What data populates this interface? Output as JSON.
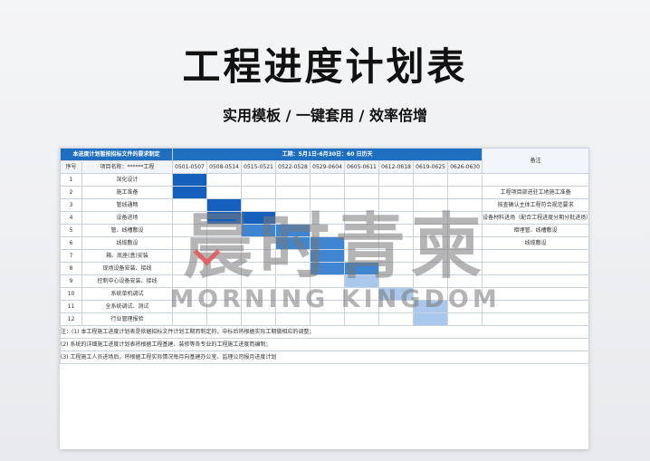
{
  "page": {
    "title": "工程进度计划表",
    "subtitle": "实用模板 / 一键套用 / 效率倍增"
  },
  "table": {
    "top_left_header": "本进度计划暂按招标文件的要求制定",
    "duration_header": "工期：5月1日-6月30日：60 日历天",
    "remarks_header": "备注",
    "col_seq": "序号",
    "col_project": "项目名称：******工程",
    "periods": [
      "0501-0507",
      "0508-0514",
      "0515-0521",
      "0522-0528",
      "0529-0604",
      "0605-0611",
      "0612-0618",
      "0619-0625",
      "0626-0630"
    ],
    "rows": [
      {
        "no": "1",
        "name": "深化设计",
        "remark": ""
      },
      {
        "no": "2",
        "name": "施工准备",
        "remark": "工程项目部进驻工地施工准备"
      },
      {
        "no": "3",
        "name": "管线通畅",
        "remark": "核查确认主体工程符合规范要求"
      },
      {
        "no": "4",
        "name": "设备进场",
        "remark": "设备材料进场（配合工程进度分期分批进场）"
      },
      {
        "no": "5",
        "name": "管、线槽敷设",
        "remark": "暗埋管、线槽敷设"
      },
      {
        "no": "6",
        "name": "线缆敷设",
        "remark": "线缆敷设"
      },
      {
        "no": "7",
        "name": "箱、底座(盒)安装",
        "remark": ""
      },
      {
        "no": "8",
        "name": "现场设备安装、接线",
        "remark": ""
      },
      {
        "no": "9",
        "name": "控制中心设备安装、接线",
        "remark": ""
      },
      {
        "no": "10",
        "name": "系统单机调试",
        "remark": ""
      },
      {
        "no": "11",
        "name": "全系统调试、测试",
        "remark": ""
      },
      {
        "no": "12",
        "name": "行业管理报验",
        "remark": ""
      }
    ],
    "bars": [
      {
        "row": 0,
        "start": 0,
        "end": 1,
        "shade": "dark"
      },
      {
        "row": 1,
        "start": 0,
        "end": 1,
        "shade": "dark"
      },
      {
        "row": 2,
        "start": 1,
        "end": 2,
        "shade": "dark"
      },
      {
        "row": 3,
        "start": 1,
        "end": 3,
        "shade": "dark"
      },
      {
        "row": 4,
        "start": 2,
        "end": 4,
        "shade": "mid"
      },
      {
        "row": 5,
        "start": 3,
        "end": 5,
        "shade": "mid"
      },
      {
        "row": 6,
        "start": 4,
        "end": 5,
        "shade": "mid"
      },
      {
        "row": 7,
        "start": 4,
        "end": 6,
        "shade": "mid"
      },
      {
        "row": 8,
        "start": 5,
        "end": 6,
        "shade": "light"
      },
      {
        "row": 9,
        "start": 6,
        "end": 7,
        "shade": "light"
      },
      {
        "row": 10,
        "start": 7,
        "end": 8,
        "shade": "light"
      },
      {
        "row": 11,
        "start": 7,
        "end": 8,
        "shade": "light"
      }
    ],
    "notes": [
      "注：(1) 本工程施工进度计划表是依据招标文件计划工期而制定的，中标后将根据实际工期做相应的调整；",
      "(2) 系统的详细施工进度计划表将根据工程基建、装修等各专业的工程施工进度而编制；",
      "(3) 工程施工人员进场后，将根据工程实际情况每月向基建办公室、监理公司报月进度计划"
    ]
  },
  "watermark": {
    "cn": "晨时青柬",
    "en": "MORNING KINGDOM"
  }
}
